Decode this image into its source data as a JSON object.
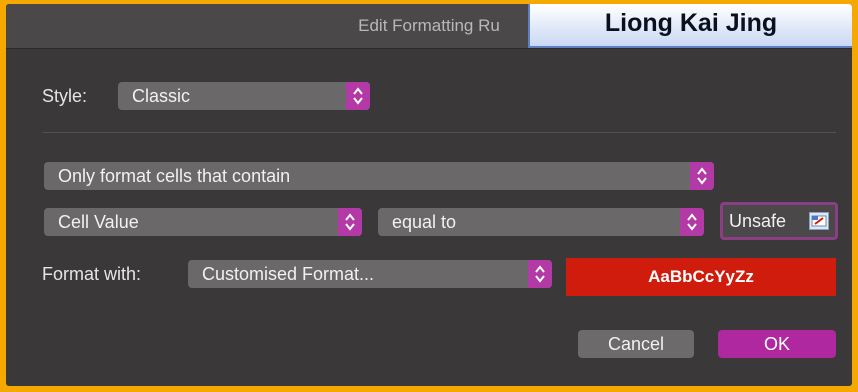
{
  "dialog": {
    "title": "Edit Formatting Ru",
    "style_label": "Style:",
    "style_value": "Classic",
    "rule_type": "Only format cells that contain",
    "condition_field": "Cell Value",
    "condition_operator": "equal to",
    "condition_value": "Unsafe",
    "format_label": "Format with:",
    "format_value": "Customised Format...",
    "preview_text": "AaBbCcYyZz",
    "preview_color": "#d01c0c",
    "cancel_label": "Cancel",
    "ok_label": "OK"
  },
  "overlay": {
    "name_tag": "Liong Kai Jing"
  },
  "colors": {
    "accent": "#b33aa6",
    "background": "#3a3839",
    "frame": "#f5a800"
  },
  "icons": {
    "stepper": "chevron-updown-icon",
    "cell_reference": "cell-reference-icon"
  }
}
